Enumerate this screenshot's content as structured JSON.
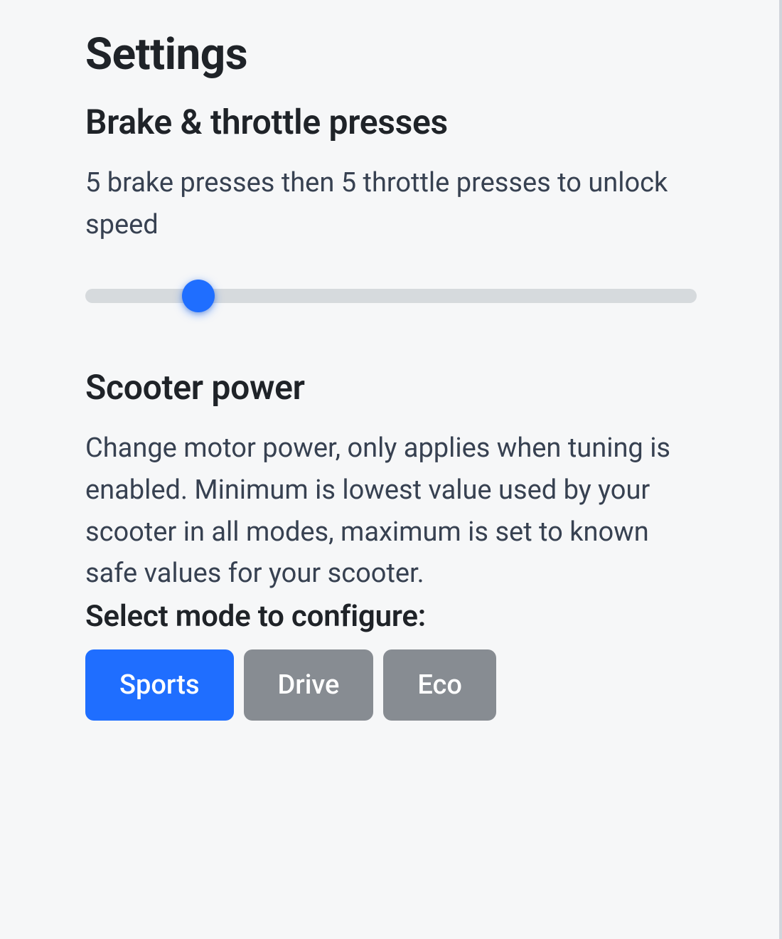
{
  "page": {
    "title": "Settings"
  },
  "brake_throttle": {
    "title": "Brake & throttle presses",
    "description": "5 brake presses then 5 throttle presses to unlock speed",
    "slider": {
      "min": 0,
      "max": 100,
      "value": 18
    }
  },
  "scooter_power": {
    "title": "Scooter power",
    "description": "Change motor power, only applies when tuning is enabled. Minimum is lowest value used by your scooter in all modes, maximum is set to known safe values for your scooter.",
    "select_label": "Select mode to configure:",
    "modes": [
      {
        "label": "Sports",
        "active": true
      },
      {
        "label": "Drive",
        "active": false
      },
      {
        "label": "Eco",
        "active": false
      }
    ]
  },
  "colors": {
    "accent": "#1f6eff",
    "inactive_button": "#878c92",
    "track": "#d6dadd",
    "bg": "#f6f7f8",
    "text": "#1f2328"
  }
}
